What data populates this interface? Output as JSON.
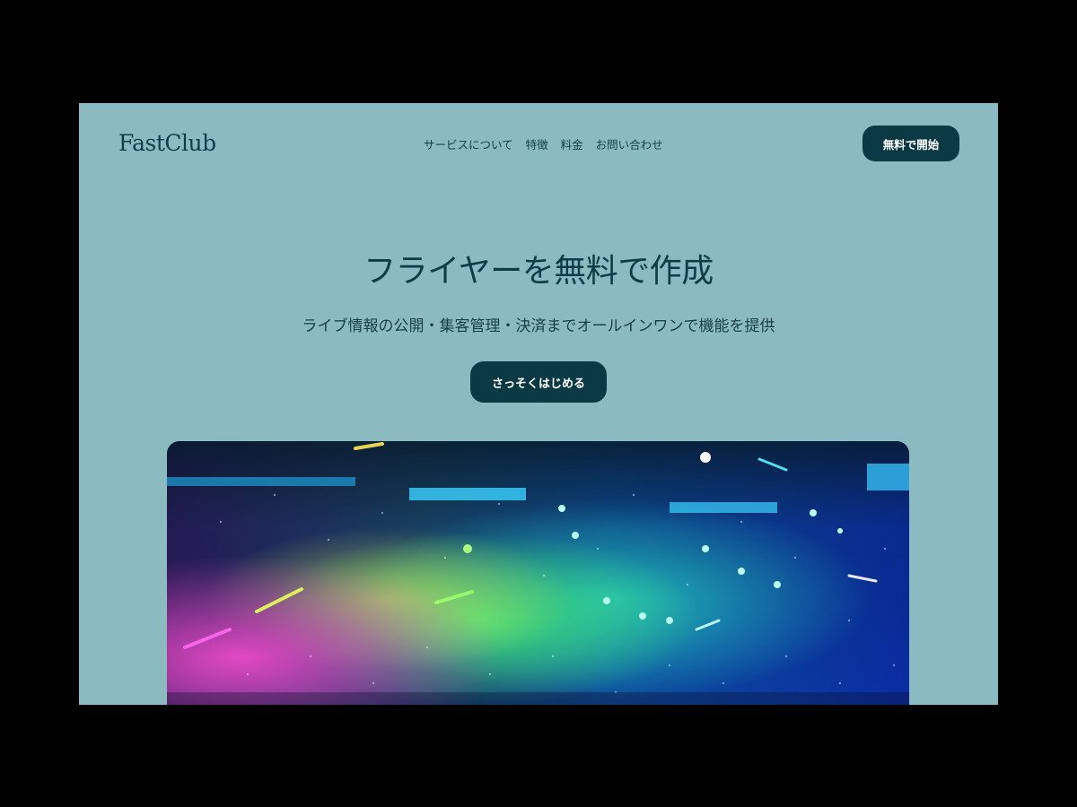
{
  "header": {
    "logo": "FastClub",
    "nav": [
      "サービスについて",
      "特徴",
      "料金",
      "お問い合わせ"
    ],
    "cta_label": "無料で開始"
  },
  "hero": {
    "title": "フライヤーを無料で作成",
    "subtitle": "ライブ情報の公開・集客管理・決済までオールインワンで機能を提供",
    "cta_label": "さっそくはじめる"
  },
  "colors": {
    "background": "#8bbac1",
    "primary": "#0c3a44",
    "text": "#0e3c47"
  },
  "icons": {
    "hero_image": "concert-lights-photo"
  }
}
